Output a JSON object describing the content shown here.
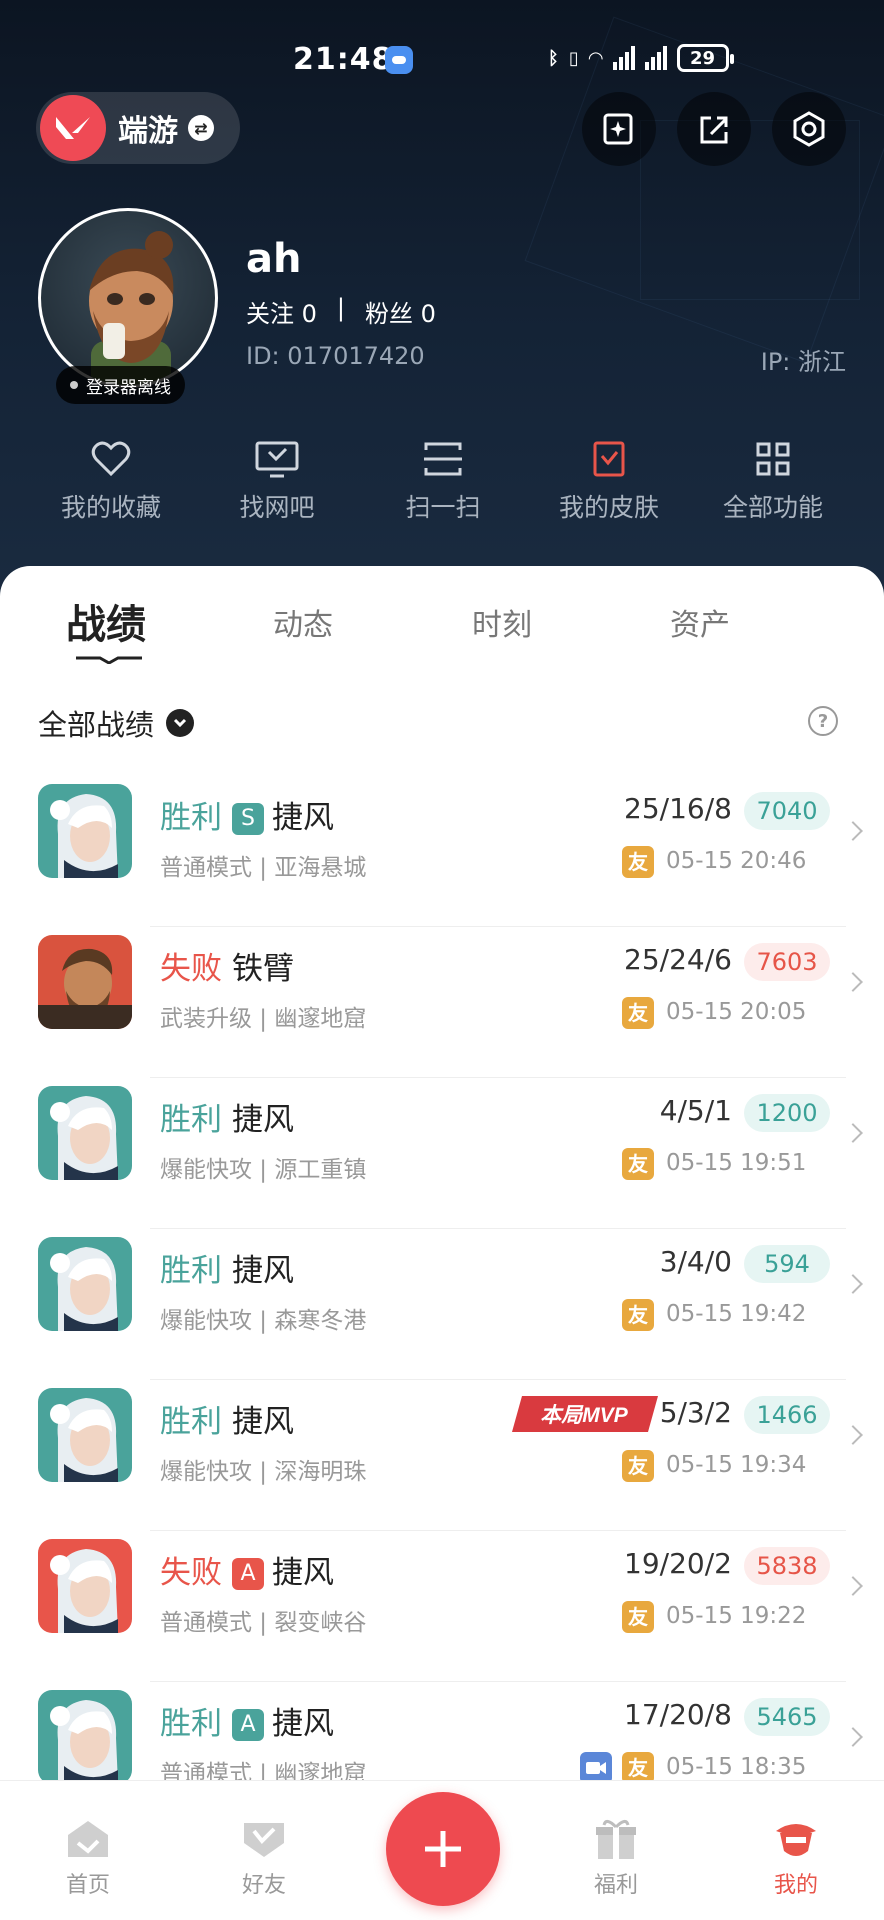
{
  "status_bar": {
    "time": "21:48",
    "battery": "29"
  },
  "account": {
    "name": "端游"
  },
  "profile": {
    "username": "ah",
    "following_label": "关注 0",
    "divider": "|",
    "followers_label": "粉丝 0",
    "id_text": "ID: 017017420",
    "ip_text": "IP: 浙江",
    "status": "登录器离线"
  },
  "functions": [
    {
      "label": "我的收藏",
      "icon": "heart-icon"
    },
    {
      "label": "找网吧",
      "icon": "monitor-icon"
    },
    {
      "label": "扫一扫",
      "icon": "scan-icon"
    },
    {
      "label": "我的皮肤",
      "icon": "skin-icon"
    },
    {
      "label": "全部功能",
      "icon": "grid-icon"
    }
  ],
  "tabs": [
    "战绩",
    "动态",
    "时刻",
    "资产"
  ],
  "filter": {
    "label": "全部战绩"
  },
  "matches": [
    {
      "result": "胜利",
      "outcome": "win",
      "rank": "S",
      "agent": "捷风",
      "mode": "普通模式 | 亚海悬城",
      "kda": "25/16/8",
      "score": "7040",
      "tag": "友",
      "date": "05-15 20:46",
      "hero": "jett",
      "bg": "#4aa39b"
    },
    {
      "result": "失败",
      "outcome": "lose",
      "rank": "",
      "agent": "铁臂",
      "mode": "武装升级 | 幽邃地窟",
      "kda": "25/24/6",
      "score": "7603",
      "tag": "友",
      "date": "05-15 20:05",
      "hero": "breach",
      "bg": "#d9533e"
    },
    {
      "result": "胜利",
      "outcome": "win",
      "rank": "",
      "agent": "捷风",
      "mode": "爆能快攻 | 源工重镇",
      "kda": "4/5/1",
      "score": "1200",
      "tag": "友",
      "date": "05-15 19:51",
      "hero": "jett",
      "bg": "#4aa39b"
    },
    {
      "result": "胜利",
      "outcome": "win",
      "rank": "",
      "agent": "捷风",
      "mode": "爆能快攻 | 森寒冬港",
      "kda": "3/4/0",
      "score": "594",
      "tag": "友",
      "date": "05-15 19:42",
      "hero": "jett",
      "bg": "#4aa39b"
    },
    {
      "result": "胜利",
      "outcome": "win",
      "rank": "",
      "agent": "捷风",
      "mode": "爆能快攻 | 深海明珠",
      "kda": "5/3/2",
      "score": "1466",
      "tag": "友",
      "date": "05-15 19:34",
      "hero": "jett",
      "bg": "#4aa39b",
      "mvp": "本局MVP"
    },
    {
      "result": "失败",
      "outcome": "lose",
      "rank": "A",
      "agent": "捷风",
      "mode": "普通模式 | 裂变峡谷",
      "kda": "19/20/2",
      "score": "5838",
      "tag": "友",
      "date": "05-15 19:22",
      "hero": "jett",
      "bg": "#e8554a"
    },
    {
      "result": "胜利",
      "outcome": "win",
      "rank": "A",
      "agent": "捷风",
      "mode": "普通模式 | 幽邃地窟",
      "kda": "17/20/8",
      "score": "5465",
      "tag": "友",
      "date": "05-15 18:35",
      "hero": "jett",
      "bg": "#4aa39b",
      "video": true
    }
  ],
  "nav": [
    {
      "label": "首页",
      "icon": "home-icon"
    },
    {
      "label": "好友",
      "icon": "friends-icon"
    },
    {
      "label": "福利",
      "icon": "gift-icon"
    },
    {
      "label": "我的",
      "icon": "profile-icon"
    }
  ],
  "colors": {
    "win": "#4aa39b",
    "lose": "#e8554a",
    "accent": "#ee4a50"
  }
}
